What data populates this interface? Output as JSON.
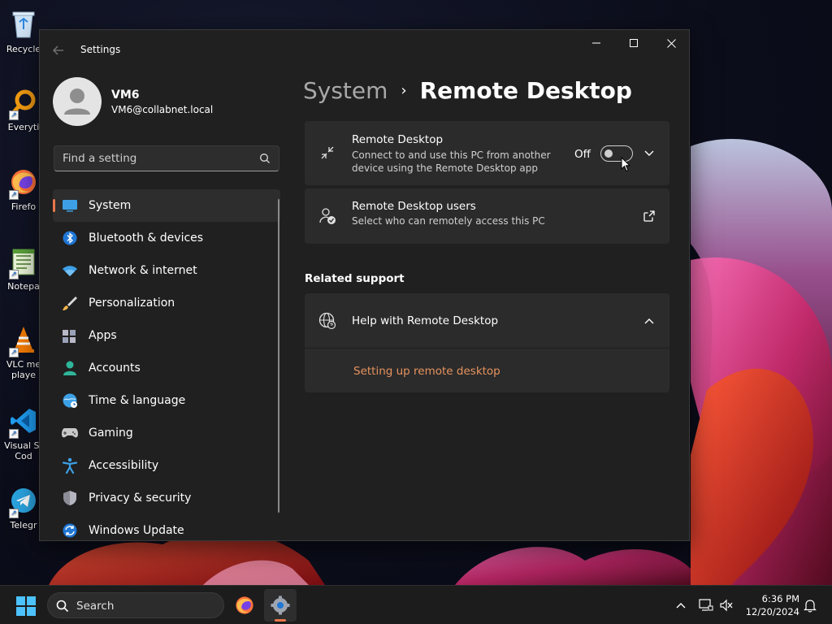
{
  "desktop": {
    "icons": [
      {
        "label": "Recycle"
      },
      {
        "label": "Everyti"
      },
      {
        "label": "Firefo"
      },
      {
        "label": "Notepa"
      },
      {
        "label": "VLC me"
      },
      {
        "label": "playe"
      },
      {
        "label": "Visual St"
      },
      {
        "label": "Cod"
      },
      {
        "label": "Telegr"
      }
    ]
  },
  "window": {
    "title": "Settings",
    "controls": {
      "minimize": "—",
      "maximize": "☐",
      "close": "✕"
    }
  },
  "user": {
    "name": "VM6",
    "email": "VM6@collabnet.local"
  },
  "search": {
    "placeholder": "Find a setting"
  },
  "nav": {
    "items": [
      {
        "label": "System",
        "icon": "monitor-icon",
        "active": true
      },
      {
        "label": "Bluetooth & devices",
        "icon": "bluetooth-icon"
      },
      {
        "label": "Network & internet",
        "icon": "wifi-icon"
      },
      {
        "label": "Personalization",
        "icon": "brush-icon"
      },
      {
        "label": "Apps",
        "icon": "apps-icon"
      },
      {
        "label": "Accounts",
        "icon": "person-icon"
      },
      {
        "label": "Time & language",
        "icon": "globe-clock-icon"
      },
      {
        "label": "Gaming",
        "icon": "gamepad-icon"
      },
      {
        "label": "Accessibility",
        "icon": "accessibility-icon"
      },
      {
        "label": "Privacy & security",
        "icon": "shield-icon"
      },
      {
        "label": "Windows Update",
        "icon": "update-icon"
      }
    ]
  },
  "breadcrumb": {
    "parent": "System",
    "separator": "›",
    "current": "Remote Desktop"
  },
  "remote_desktop": {
    "title": "Remote Desktop",
    "description_line1": "Connect to and use this PC from another",
    "description_line2": "device using the Remote Desktop app",
    "toggle_state_label": "Off",
    "toggle_on": false
  },
  "remote_users": {
    "title": "Remote Desktop users",
    "description": "Select who can remotely access this PC"
  },
  "related_support": {
    "heading": "Related support",
    "help_title": "Help with Remote Desktop",
    "link": "Setting up remote desktop"
  },
  "taskbar": {
    "search_label": "Search",
    "time": "6:36 PM",
    "date": "12/20/2024"
  },
  "colors": {
    "accent": "#e8764a",
    "link": "#e8935e",
    "window_bg": "#202020",
    "card_bg": "#2b2b2b"
  }
}
